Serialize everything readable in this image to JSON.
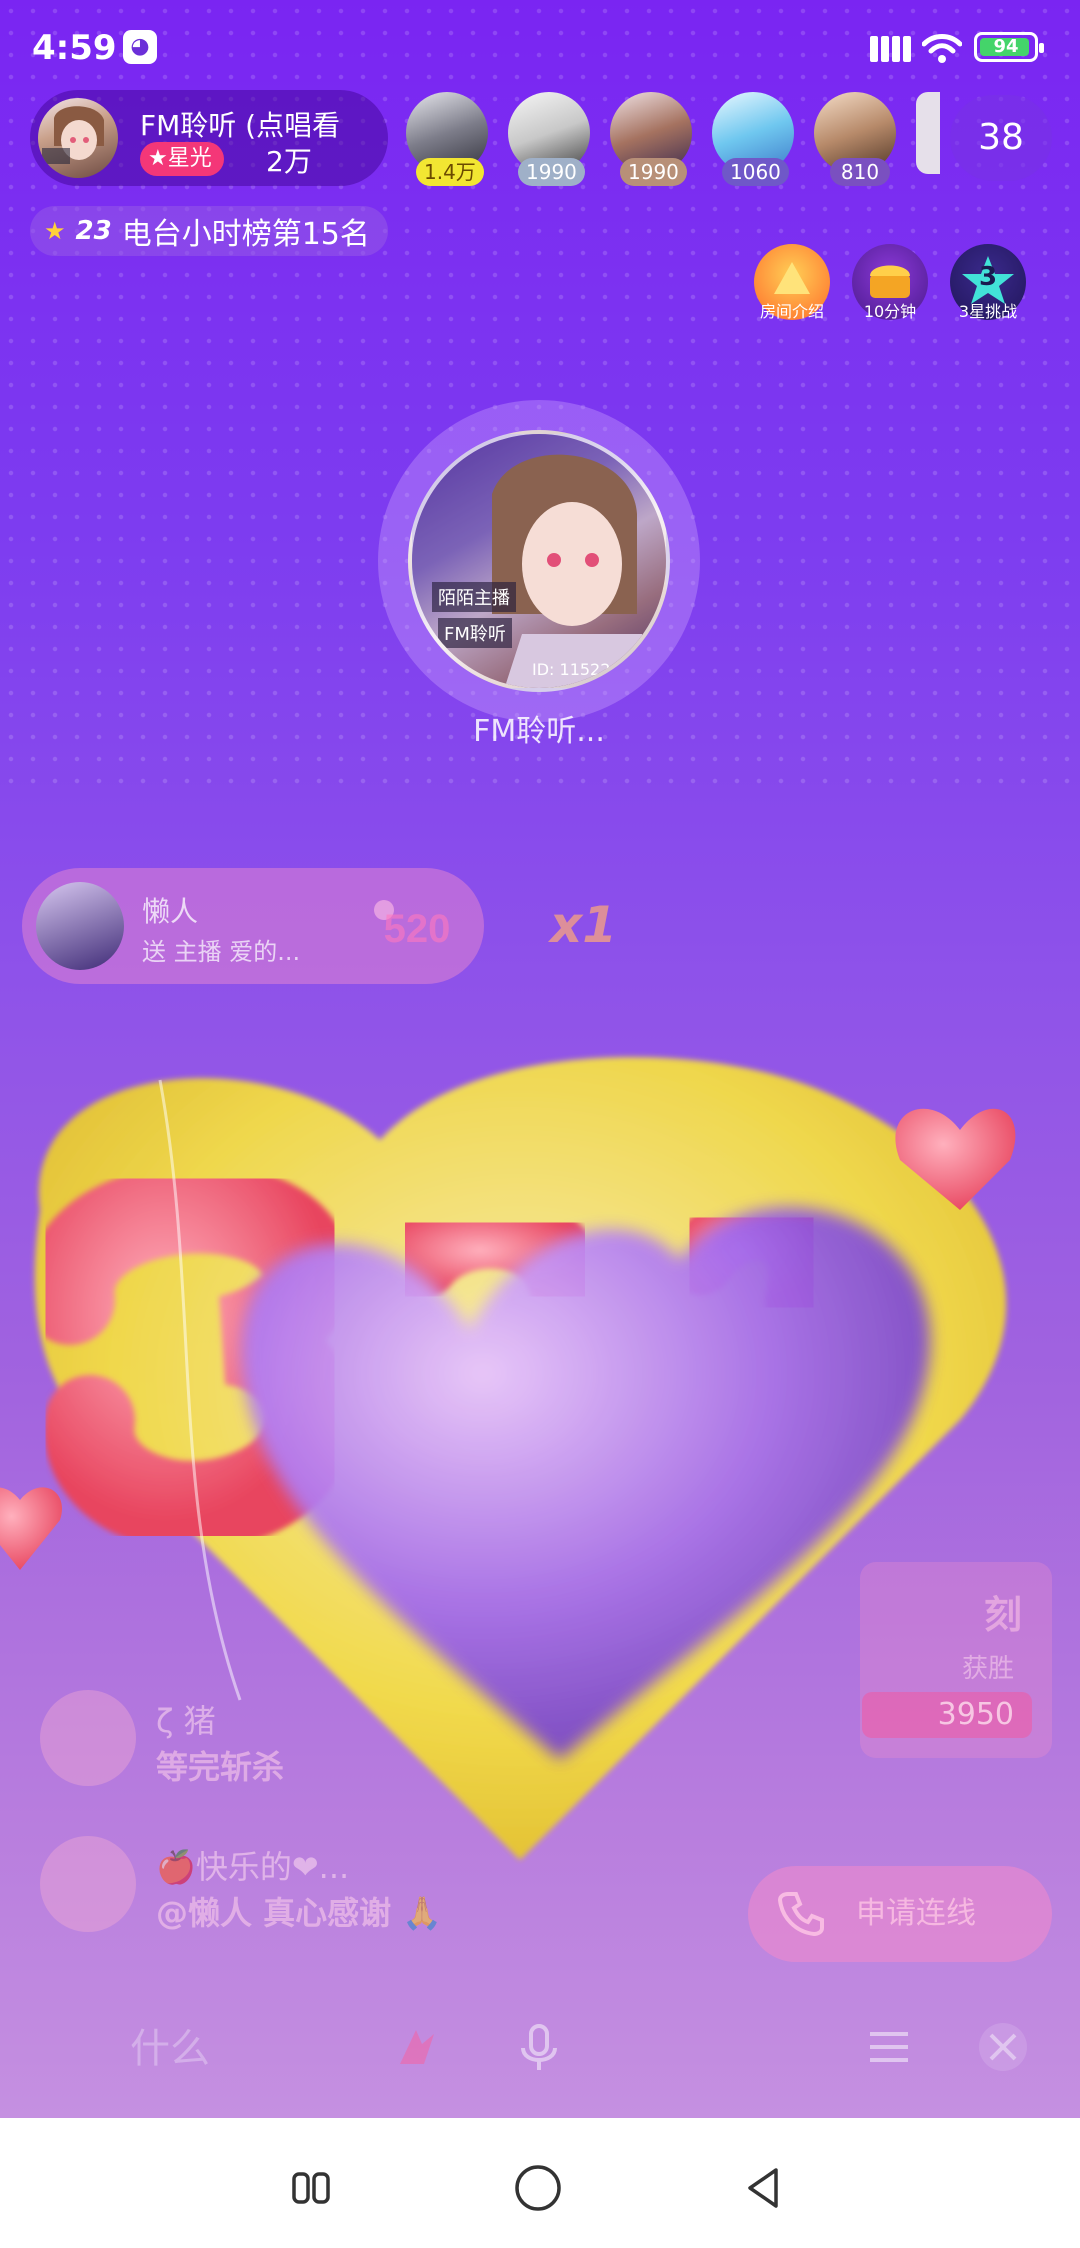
{
  "status_bar": {
    "time": "4:59",
    "battery": "94",
    "app_icon": "chat-bubble-icon",
    "battery_level": 0.94
  },
  "host": {
    "name": "FM聆听 (点唱看",
    "star_badge": "星光",
    "star_count": "2万"
  },
  "rank": {
    "level": "23",
    "text": "电台小时榜第15名"
  },
  "viewers": [
    {
      "count": "1.4万",
      "badge_color": "#f2e632"
    },
    {
      "count": "1990",
      "badge_color": "#9fb0c8"
    },
    {
      "count": "1990",
      "badge_color": "#b89078"
    },
    {
      "count": "1060",
      "badge_color": "#6f58c8"
    },
    {
      "count": "810",
      "badge_color": "#7a50c0"
    }
  ],
  "online_count": "38",
  "features": [
    {
      "label": "房间介绍",
      "icon": "info-icon"
    },
    {
      "label": "10分钟",
      "icon": "treasure-chest-icon"
    },
    {
      "label": "3星挑战",
      "icon": "star-challenge-icon",
      "badge": "3"
    }
  ],
  "mic_seat": {
    "name": "FM聆听...",
    "avatar_text_1": "陌陌主播",
    "avatar_text_2": "FM聆听",
    "avatar_id": "ID: 11522"
  },
  "gift_banner": {
    "sender": "懒人",
    "text": "送 主播  爱的...",
    "multiplier": "x1",
    "gift_icon": "520"
  },
  "chat": [
    {
      "name": "ζ 猪",
      "message": "等完斩杀"
    },
    {
      "name": "🍎快乐的❤...",
      "message": "@懒人 真心感谢 🙏"
    }
  ],
  "pk_card": {
    "title": "刻",
    "subtitle": "获胜",
    "score": "3950"
  },
  "link_button": {
    "label": "申请连线"
  },
  "input_bar": {
    "placeholder": "什么"
  },
  "colors": {
    "accent_pink": "#f43778",
    "background_top": "#7a25f2",
    "background_bottom": "#c590e1"
  }
}
